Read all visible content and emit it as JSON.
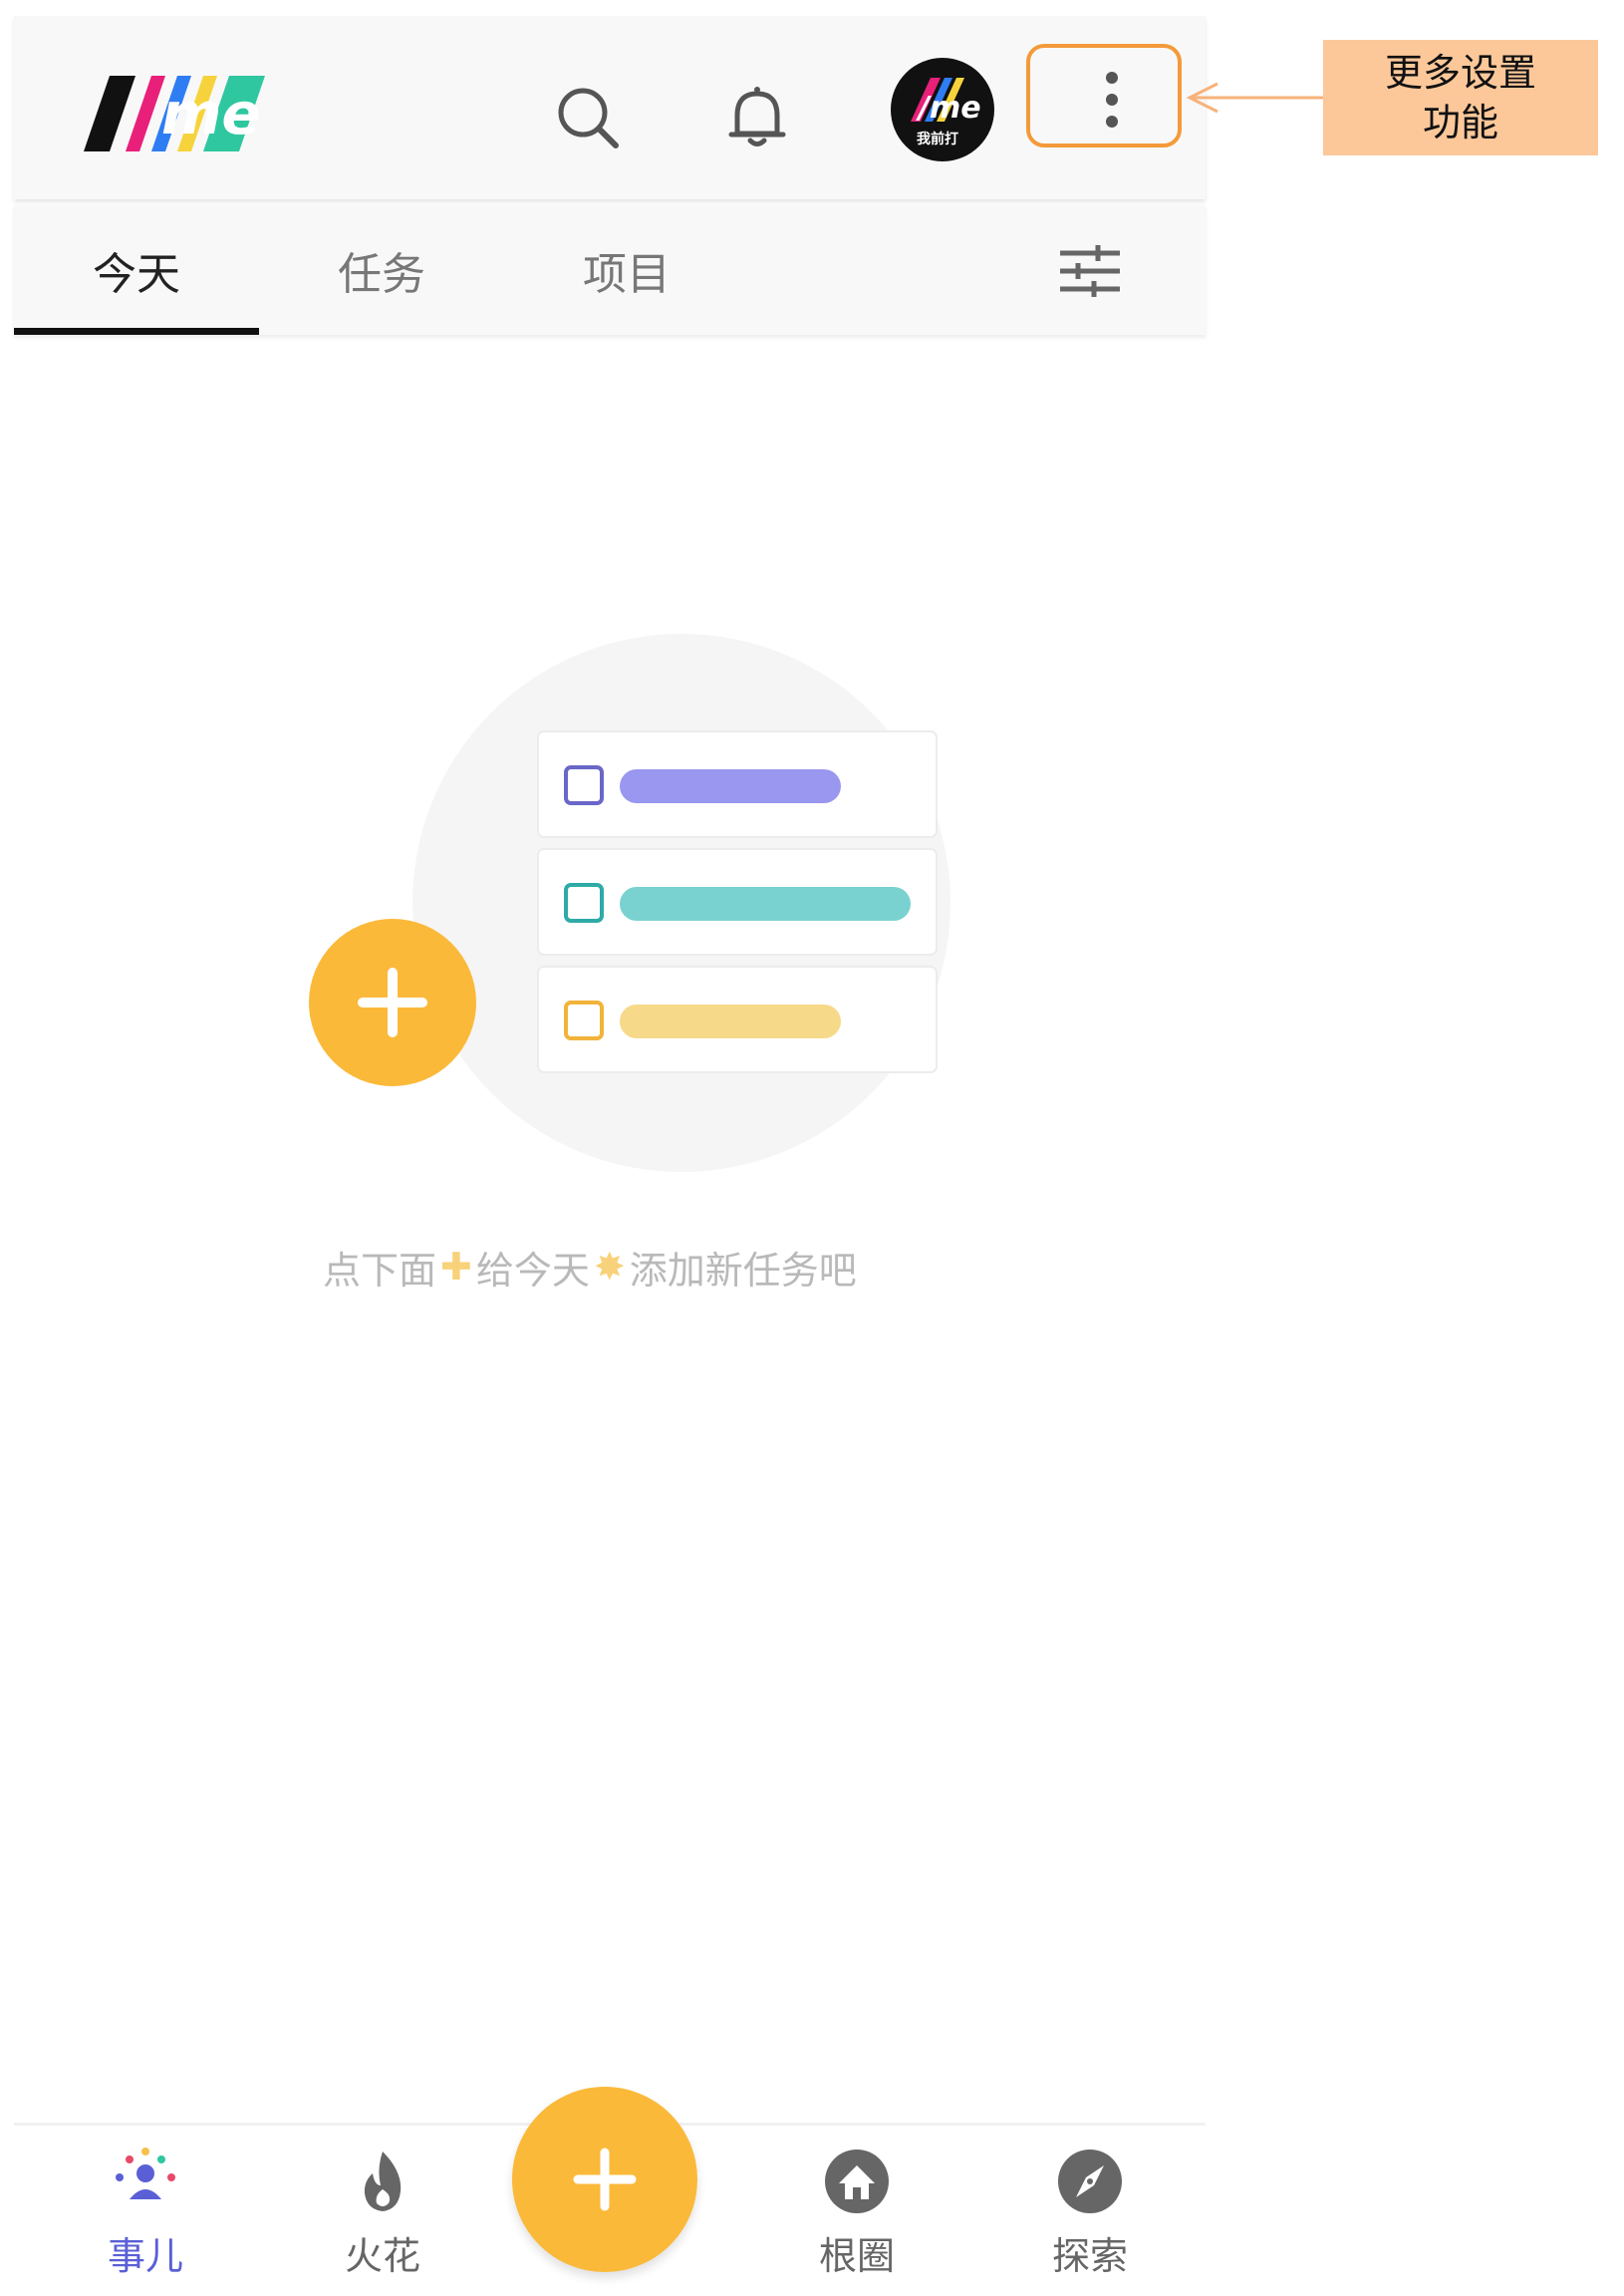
{
  "app": {
    "logo_text": "/me"
  },
  "header": {
    "search_icon": "search-icon",
    "bell_icon": "bell-icon",
    "avatar_text": "/me",
    "avatar_sub": "我前打",
    "more_icon": "more-vertical-icon"
  },
  "tabs": [
    {
      "label": "今天",
      "active": true
    },
    {
      "label": "任务",
      "active": false
    },
    {
      "label": "项目",
      "active": false
    }
  ],
  "filter_icon": "sliders-icon",
  "empty_state": {
    "hint_part1": "点下面",
    "hint_part2": "给今天",
    "hint_part3": "添加新任务吧",
    "plus_glyph": "✚",
    "sun_glyph": "✸",
    "illustration": {
      "checkbox_colors": [
        "#6a67c8",
        "#2eaaa7",
        "#f2b33a"
      ],
      "bar_colors": [
        "#9a97f0",
        "#79d2cf",
        "#f7d98a"
      ],
      "add_button_color": "#fbb93a"
    }
  },
  "bottom_nav": [
    {
      "label": "事儿",
      "icon": "people-icon",
      "active": true
    },
    {
      "label": "火花",
      "icon": "flame-icon",
      "active": false
    },
    {
      "label": "根圈",
      "icon": "home-icon",
      "active": false
    },
    {
      "label": "探索",
      "icon": "compass-icon",
      "active": false
    }
  ],
  "fab": {
    "icon": "plus-icon",
    "color": "#fbb93a"
  },
  "annotation": {
    "line1": "更多设置",
    "line2": "功能",
    "highlight_color": "#f49a3a",
    "callout_color": "#fcc89a"
  },
  "colors": {
    "accent": "#fbb93a",
    "active_nav": "#5a5fd6"
  }
}
